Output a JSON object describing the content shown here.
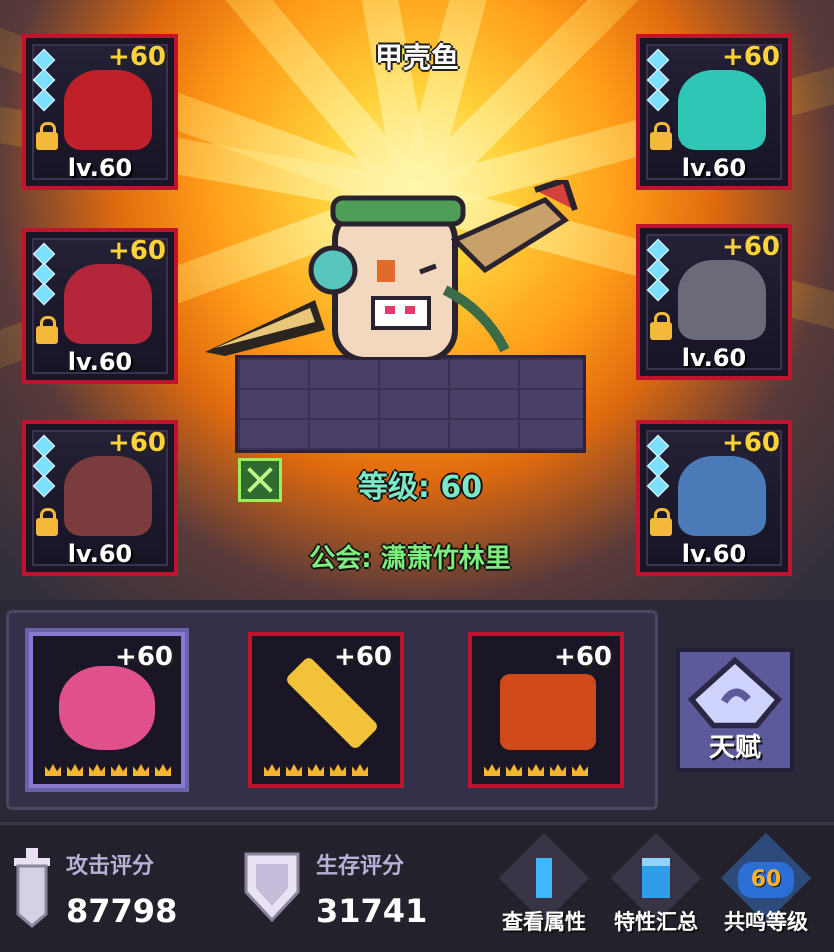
{
  "character": {
    "name": "甲壳鱼",
    "level_label": "等级: 60",
    "guild_label": "公会: 潇萧竹林里"
  },
  "equipment_left": [
    {
      "plus": "+60",
      "level": "lv.60",
      "art_color": "#c0202a"
    },
    {
      "plus": "+60",
      "level": "lv.60",
      "art_color": "#b4263a"
    },
    {
      "plus": "+60",
      "level": "lv.60",
      "art_color": "#7a3c3c"
    }
  ],
  "equipment_right": [
    {
      "plus": "+60",
      "level": "lv.60",
      "art_color": "#2fc6b5"
    },
    {
      "plus": "+60",
      "level": "lv.60",
      "art_color": "#6a6a78"
    },
    {
      "plus": "+60",
      "level": "lv.60",
      "art_color": "#4a7ab8"
    }
  ],
  "weapons": [
    {
      "plus": "+60",
      "art_color": "#e0508a"
    },
    {
      "plus": "+60",
      "art_color": "#f2c23a"
    },
    {
      "plus": "+60",
      "art_color": "#d04a1a"
    }
  ],
  "talent": {
    "label": "天赋"
  },
  "scores": {
    "attack_label": "攻击评分",
    "attack_value": "87798",
    "survival_label": "生存评分",
    "survival_value": "31741"
  },
  "buttons": {
    "view_attributes": "查看属性",
    "traits_summary": "特性汇总",
    "resonance_level": "共鸣等级",
    "resonance_badge": "60"
  },
  "colors": {
    "accent_gold": "#ffd23a",
    "slot_border": "#c0142e",
    "level_text": "#7de8c8",
    "guild_text": "#7cf07c"
  }
}
